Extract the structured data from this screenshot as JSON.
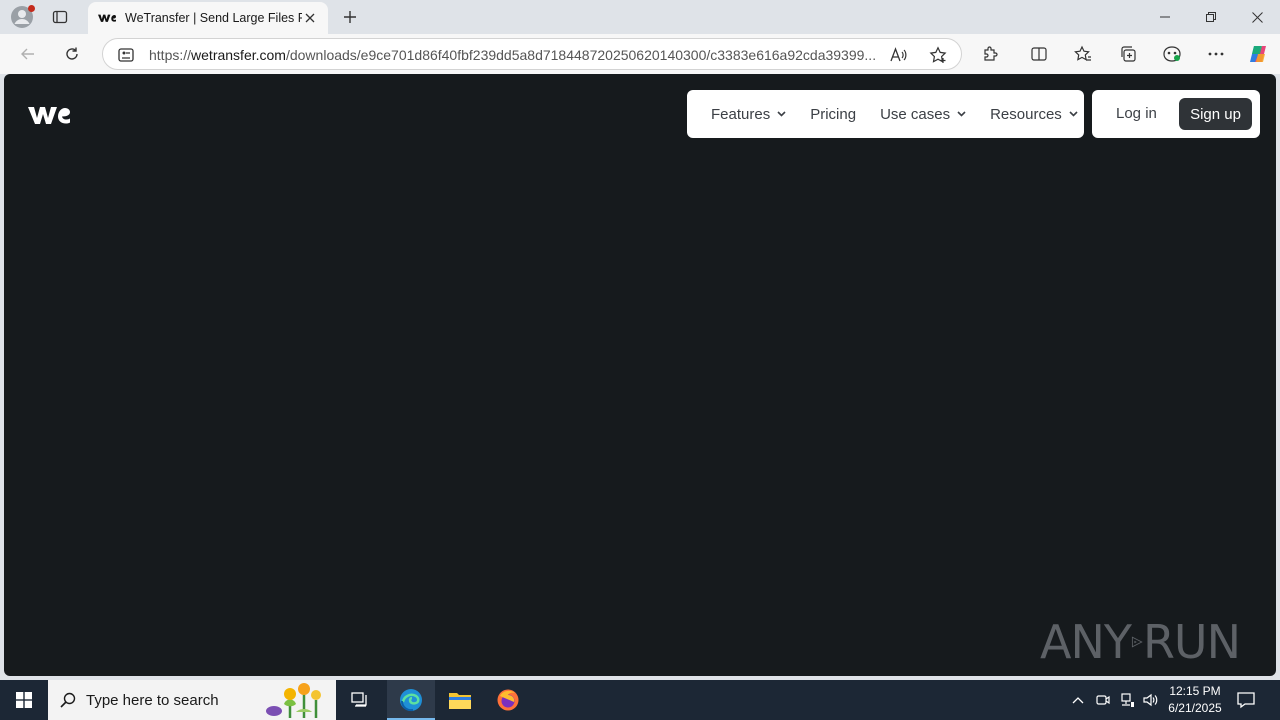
{
  "browser": {
    "tab": {
      "title": "WeTransfer | Send Large Files Fast"
    },
    "address": {
      "url_scheme": "https://",
      "url_host": "wetransfer.com",
      "url_path": "/downloads/e9ce701d86f40fbf239dd5a8d71844872025062014030​0/c3383e616a92cda39399..."
    }
  },
  "page": {
    "nav": {
      "features": "Features",
      "pricing": "Pricing",
      "use_cases": "Use cases",
      "resources": "Resources"
    },
    "auth": {
      "login": "Log in",
      "signup": "Sign up"
    },
    "watermark": {
      "left": "ANY",
      "right": "RUN"
    }
  },
  "taskbar": {
    "search_placeholder": "Type here to search",
    "time": "12:15 PM",
    "date": "6/21/2025"
  },
  "colors": {
    "page_bg": "#161a1d",
    "signup_bg": "#2f3337",
    "taskbar_bg": "#1c2735"
  }
}
